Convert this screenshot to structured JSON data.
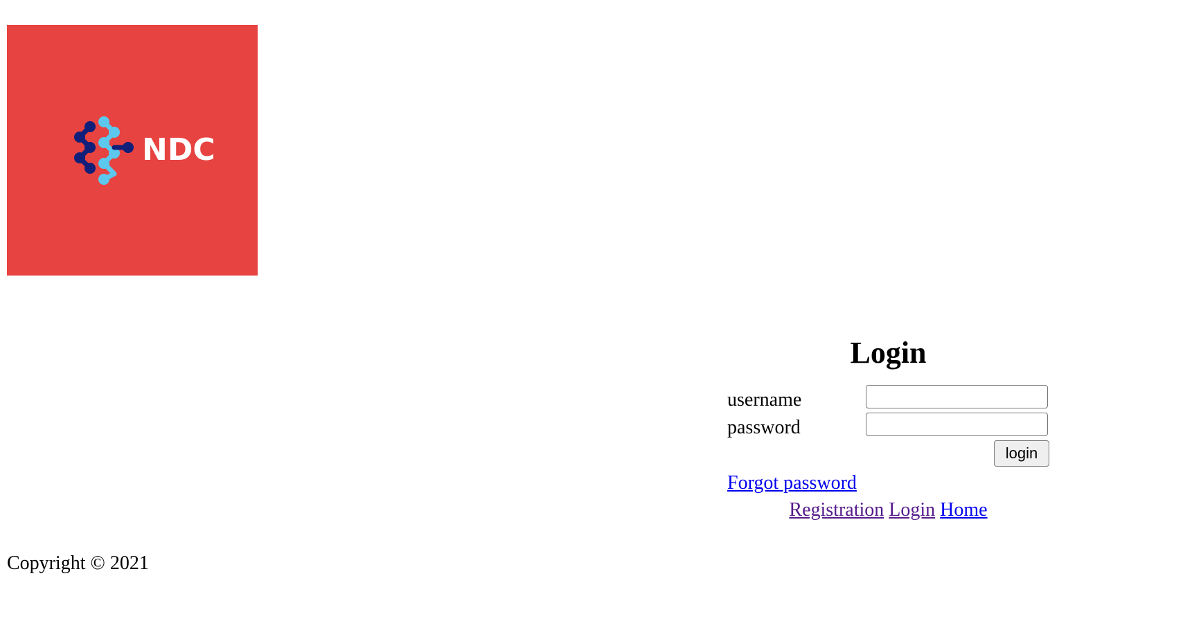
{
  "logo": {
    "text": "NDC",
    "background_color": "#e74340",
    "dark_dot_color": "#0f1f7a",
    "light_dot_color": "#5cc8ee",
    "text_color": "#ffffff"
  },
  "login": {
    "title": "Login",
    "username_label": "username",
    "username_value": "",
    "password_label": "password",
    "password_value": "",
    "submit_label": "login",
    "forgot_link": "Forgot password"
  },
  "nav": {
    "registration": "Registration",
    "login": "Login",
    "home": "Home"
  },
  "colors": {
    "link": "#0000ee",
    "visited_link": "#551a8b"
  },
  "footer": {
    "copyright": "Copyright © 2021"
  }
}
